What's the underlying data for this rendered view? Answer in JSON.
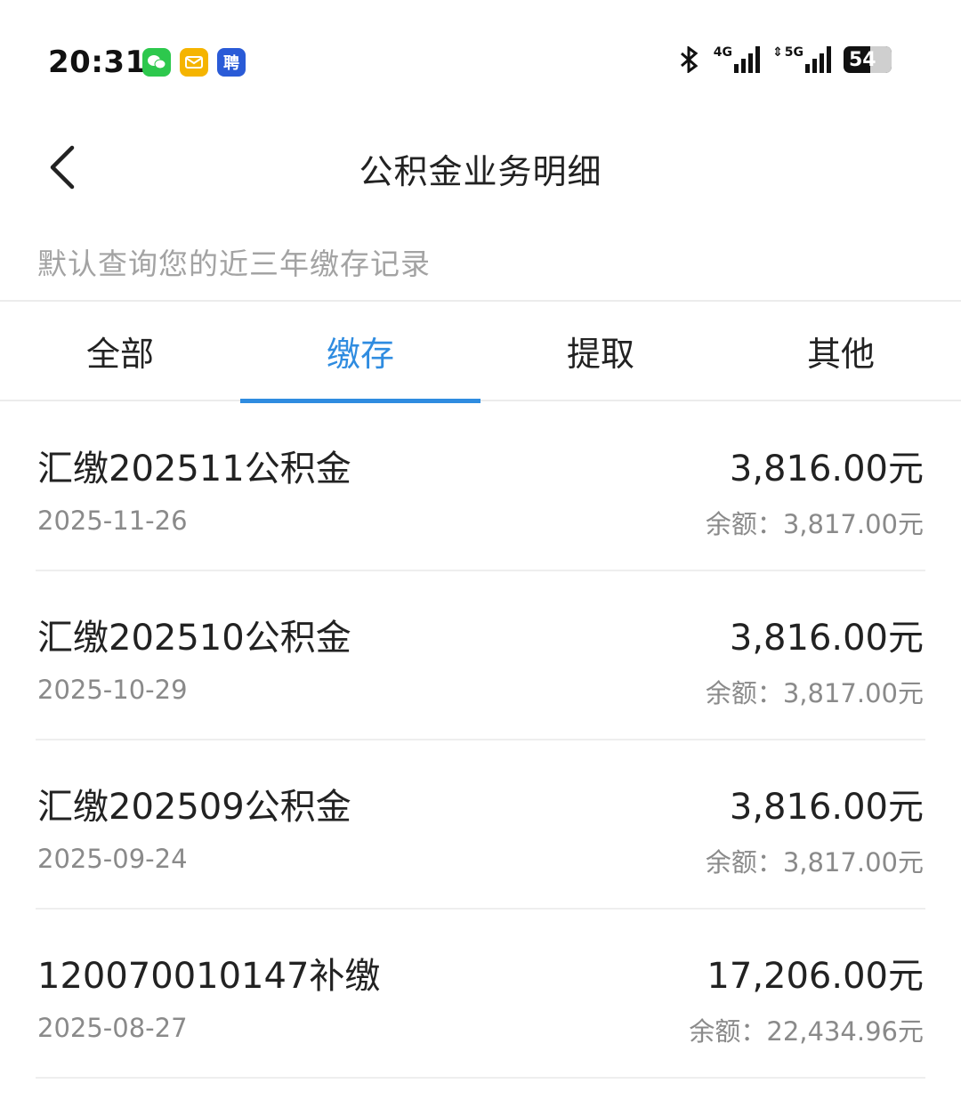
{
  "status_bar": {
    "time": "20:31",
    "apps": [
      {
        "icon": "wechat-icon",
        "color": "#2dc84d",
        "glyph": "✉"
      },
      {
        "icon": "mail-icon",
        "color": "#f5b400",
        "glyph": "✉"
      },
      {
        "icon": "pin-app-icon",
        "color": "#2a5bd7",
        "glyph": "聘"
      }
    ],
    "network1": "4G",
    "network2": "5G",
    "battery": "54"
  },
  "header": {
    "title": "公积金业务明细",
    "back_icon": "chevron-left-icon"
  },
  "hint": "默认查询您的近三年缴存记录",
  "tabs": [
    {
      "label": "全部",
      "active": false
    },
    {
      "label": "缴存",
      "active": true
    },
    {
      "label": "提取",
      "active": false
    },
    {
      "label": "其他",
      "active": false
    }
  ],
  "accent_color": "#2f8ce0",
  "records": [
    {
      "title": "汇缴202511公积金",
      "date": "2025-11-26",
      "amount": "3,816.00元",
      "balance": "余额：3,817.00元"
    },
    {
      "title": "汇缴202510公积金",
      "date": "2025-10-29",
      "amount": "3,816.00元",
      "balance": "余额：3,817.00元"
    },
    {
      "title": "汇缴202509公积金",
      "date": "2025-09-24",
      "amount": "3,816.00元",
      "balance": "余额：3,817.00元"
    },
    {
      "title": "120070010147补缴",
      "date": "2025-08-27",
      "amount": "17,206.00元",
      "balance": "余额：22,434.96元"
    }
  ]
}
